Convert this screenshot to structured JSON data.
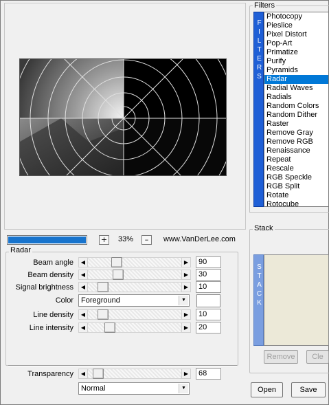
{
  "preview": {
    "zoom": "33%",
    "zoom_in": "+",
    "zoom_out": "–",
    "url": "www.VanDerLee.com",
    "progress": 1.0
  },
  "radar": {
    "group_title": "Radar",
    "params": [
      {
        "label": "Beam angle",
        "value": "90",
        "slider": 0.28
      },
      {
        "label": "Beam density",
        "value": "30",
        "slider": 0.3
      },
      {
        "label": "Signal brightness",
        "value": "10",
        "slider": 0.12
      },
      {
        "label": "Line density",
        "value": "10",
        "slider": 0.12
      },
      {
        "label": "Line intensity",
        "value": "20",
        "slider": 0.2
      }
    ],
    "color_label": "Color",
    "color_value": "Foreground",
    "transparency_label": "Transparency",
    "transparency_value": "68",
    "transparency_slider": 0.06,
    "blend_mode": "Normal"
  },
  "filters": {
    "title": "Filters",
    "tab_letters": [
      "F",
      "I",
      "L",
      "T",
      "E",
      "R",
      "S"
    ],
    "items": [
      "Photocopy",
      "Pieslice",
      "Pixel Distort",
      "Pop-Art",
      "Primatize",
      "Purify",
      "Pyramids",
      "Radar",
      "Radial Waves",
      "Radials",
      "Random Colors",
      "Random Dither",
      "Raster",
      "Remove Gray",
      "Remove RGB",
      "Renaissance",
      "Repeat",
      "Rescale",
      "RGB Speckle",
      "RGB Split",
      "Rotate",
      "Rotocube"
    ],
    "selected": "Radar"
  },
  "stack": {
    "title": "Stack",
    "tab_letters": [
      "S",
      "T",
      "A",
      "C",
      "K"
    ],
    "remove_label": "Remove",
    "clear_label": "Cle"
  },
  "buttons": {
    "open": "Open",
    "save": "Save"
  },
  "colors": {
    "selection": "#0078d7",
    "filters_tab": "#1f5fd6",
    "stack_tab": "#7a9ee0",
    "progress": "#1874cd"
  }
}
